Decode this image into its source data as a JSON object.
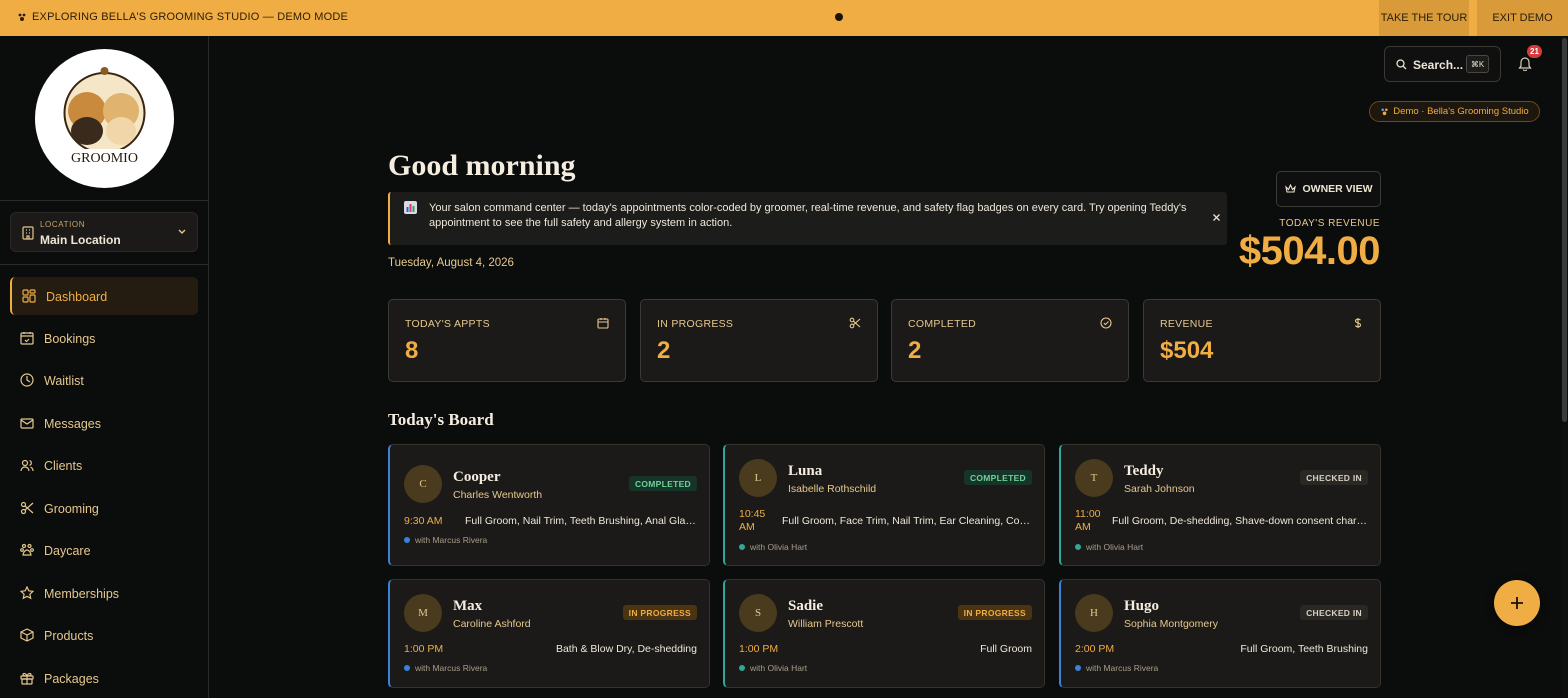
{
  "demo_bar": {
    "label": "EXPLORING BELLA'S GROOMING STUDIO — DEMO MODE",
    "tour_label": "TAKE THE TOUR",
    "exit_label": "EXIT DEMO"
  },
  "sidebar": {
    "logo_text": "GROOMIO",
    "location": {
      "sub": "LOCATION",
      "value": "Main Location"
    },
    "items": [
      {
        "label": "Dashboard",
        "icon": "dashboard-icon",
        "active": true
      },
      {
        "label": "Bookings",
        "icon": "calendar-check-icon"
      },
      {
        "label": "Waitlist",
        "icon": "clock-icon"
      },
      {
        "label": "Messages",
        "icon": "mail-icon"
      },
      {
        "label": "Clients",
        "icon": "users-icon"
      },
      {
        "label": "Grooming",
        "icon": "scissors-icon"
      },
      {
        "label": "Daycare",
        "icon": "paw-icon"
      },
      {
        "label": "Memberships",
        "icon": "star-icon"
      },
      {
        "label": "Products",
        "icon": "box-icon"
      },
      {
        "label": "Packages",
        "icon": "gift-icon"
      }
    ]
  },
  "header": {
    "search_label": "Search...",
    "search_shortcut": "⌘K",
    "notifications_count": "21",
    "demo_pill": "Demo · Bella's Grooming Studio"
  },
  "main": {
    "greeting": "Good morning",
    "banner": "Your salon command center — today's appointments color-coded by groomer, real-time revenue, and safety flag badges on every card. Try opening Teddy's appointment to see the full safety and allergy system in action.",
    "date": "Tuesday, August 4, 2026",
    "owner_view": "OWNER VIEW",
    "revenue_label": "TODAY'S REVENUE",
    "revenue_value": "$504.00",
    "board_title": "Today's Board"
  },
  "stats": [
    {
      "label": "TODAY'S APPTS",
      "value": "8",
      "icon": "calendar-icon"
    },
    {
      "label": "IN PROGRESS",
      "value": "2",
      "icon": "scissors-icon"
    },
    {
      "label": "COMPLETED",
      "value": "2",
      "icon": "check-circle-icon"
    },
    {
      "label": "REVENUE",
      "value": "$504",
      "icon": "dollar-icon"
    }
  ],
  "appointments": [
    {
      "initial": "C",
      "pet": "Cooper",
      "owner": "Charles Wentworth",
      "status": "COMPLETED",
      "time": "9:30 AM",
      "services": "Full Groom, Nail Trim, Teeth Brushing, Anal Glands",
      "groomer": "with Marcus Rivera"
    },
    {
      "initial": "L",
      "pet": "Luna",
      "owner": "Isabelle Rothschild",
      "status": "COMPLETED",
      "time": "10:45 AM",
      "services": "Full Groom, Face Trim, Nail Trim, Ear Cleaning, Cologne",
      "groomer": "with Olivia Hart"
    },
    {
      "initial": "T",
      "pet": "Teddy",
      "owner": "Sarah Johnson",
      "status": "CHECKED IN",
      "time": "11:00 AM",
      "services": "Full Groom, De-shedding, Shave-down consent charge",
      "groomer": "with Olivia Hart"
    },
    {
      "initial": "M",
      "pet": "Max",
      "owner": "Caroline Ashford",
      "status": "IN PROGRESS",
      "time": "1:00 PM",
      "services": "Bath & Blow Dry, De-shedding",
      "groomer": "with Marcus Rivera"
    },
    {
      "initial": "S",
      "pet": "Sadie",
      "owner": "William Prescott",
      "status": "IN PROGRESS",
      "time": "1:00 PM",
      "services": "Full Groom",
      "groomer": "with Olivia Hart"
    },
    {
      "initial": "H",
      "pet": "Hugo",
      "owner": "Sophia Montgomery",
      "status": "CHECKED IN",
      "time": "2:00 PM",
      "services": "Full Groom, Teeth Brushing",
      "groomer": "with Marcus Rivera"
    }
  ],
  "colors": {
    "accent": "#f0ad43",
    "groomer_marcus": "#3b82d6",
    "groomer_olivia": "#2fa89a"
  }
}
